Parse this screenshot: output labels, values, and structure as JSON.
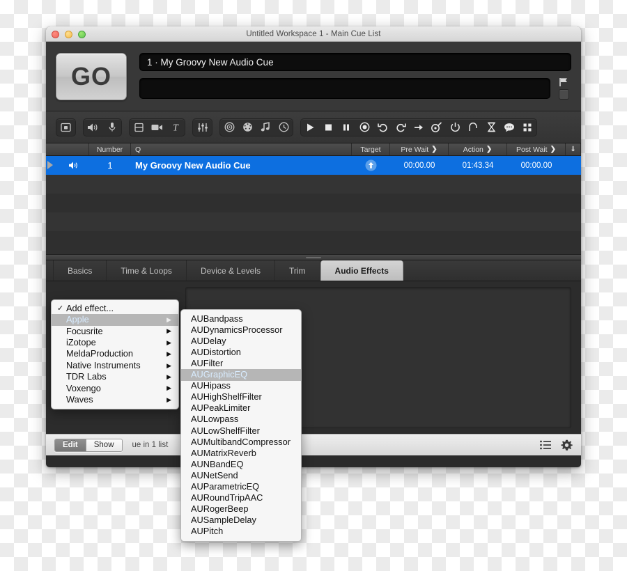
{
  "window": {
    "title": "Untitled Workspace 1 - Main Cue List",
    "traffic_lights": [
      "close",
      "minimize",
      "zoom"
    ]
  },
  "top": {
    "go_label": "GO",
    "cue_field_value": "1 · My Groovy New Audio Cue",
    "notes_field_value": "",
    "notes_placeholder": ""
  },
  "toolbar": {
    "groups": [
      {
        "name": "group-memo",
        "buttons": [
          {
            "icon": "memo-icon"
          }
        ]
      },
      {
        "name": "group-audio",
        "buttons": [
          {
            "icon": "speaker-icon"
          },
          {
            "icon": "microphone-icon"
          }
        ]
      },
      {
        "name": "group-media",
        "buttons": [
          {
            "icon": "fade-icon"
          },
          {
            "icon": "video-camera-icon"
          },
          {
            "icon": "text-icon"
          }
        ]
      },
      {
        "name": "group-levels",
        "buttons": [
          {
            "icon": "sliders-icon"
          }
        ]
      },
      {
        "name": "group-control",
        "buttons": [
          {
            "icon": "target-icon"
          },
          {
            "icon": "midi-icon"
          },
          {
            "icon": "music-note-icon"
          },
          {
            "icon": "clock-icon"
          }
        ]
      },
      {
        "name": "group-transport",
        "buttons": [
          {
            "icon": "play-icon"
          },
          {
            "icon": "stop-icon"
          },
          {
            "icon": "pause-icon"
          },
          {
            "icon": "record-icon"
          },
          {
            "icon": "undo-icon"
          },
          {
            "icon": "redo-icon"
          },
          {
            "icon": "arrow-right-icon"
          },
          {
            "icon": "goto-icon"
          },
          {
            "icon": "power-icon"
          },
          {
            "icon": "loop-icon"
          },
          {
            "icon": "hourglass-icon"
          },
          {
            "icon": "comment-icon"
          },
          {
            "icon": "grid-icon"
          }
        ]
      }
    ]
  },
  "cuelist": {
    "columns": [
      "",
      "Number",
      "Q",
      "Target",
      "Pre Wait",
      "Action",
      "Post Wait",
      ""
    ],
    "rows": [
      {
        "icon": "speaker-icon",
        "number": "1",
        "q": "My Groovy New Audio Cue",
        "target": "target-up-icon",
        "pre_wait": "00:00.00",
        "action": "01:43.34",
        "post_wait": "00:00.00",
        "selected": true
      }
    ],
    "empty_row_count": 4
  },
  "tabs": [
    {
      "label": "Basics",
      "active": false
    },
    {
      "label": "Time & Loops",
      "active": false
    },
    {
      "label": "Device & Levels",
      "active": false
    },
    {
      "label": "Trim",
      "active": false
    },
    {
      "label": "Audio Effects",
      "active": true
    }
  ],
  "bottom": {
    "segments": [
      {
        "label": "Edit",
        "active": true
      },
      {
        "label": "Show",
        "active": false
      }
    ],
    "status": "ue in 1 list",
    "icons": [
      {
        "icon": "list-icon"
      },
      {
        "icon": "gear-icon"
      }
    ]
  },
  "menu_vendors": {
    "items": [
      {
        "label": "Add effect...",
        "checked": true,
        "submenu": false,
        "highlighted": false
      },
      {
        "label": "Apple",
        "checked": false,
        "submenu": true,
        "highlighted": true
      },
      {
        "label": "Focusrite",
        "checked": false,
        "submenu": true,
        "highlighted": false
      },
      {
        "label": "iZotope",
        "checked": false,
        "submenu": true,
        "highlighted": false
      },
      {
        "label": "MeldaProduction",
        "checked": false,
        "submenu": true,
        "highlighted": false
      },
      {
        "label": "Native Instruments",
        "checked": false,
        "submenu": true,
        "highlighted": false
      },
      {
        "label": "TDR Labs",
        "checked": false,
        "submenu": true,
        "highlighted": false
      },
      {
        "label": "Voxengo",
        "checked": false,
        "submenu": true,
        "highlighted": false
      },
      {
        "label": "Waves",
        "checked": false,
        "submenu": true,
        "highlighted": false
      }
    ]
  },
  "menu_effects": {
    "items": [
      {
        "label": "AUBandpass",
        "highlighted": false
      },
      {
        "label": "AUDynamicsProcessor",
        "highlighted": false
      },
      {
        "label": "AUDelay",
        "highlighted": false
      },
      {
        "label": "AUDistortion",
        "highlighted": false
      },
      {
        "label": "AUFilter",
        "highlighted": false
      },
      {
        "label": "AUGraphicEQ",
        "highlighted": true
      },
      {
        "label": "AUHipass",
        "highlighted": false
      },
      {
        "label": "AUHighShelfFilter",
        "highlighted": false
      },
      {
        "label": "AUPeakLimiter",
        "highlighted": false
      },
      {
        "label": "AULowpass",
        "highlighted": false
      },
      {
        "label": "AULowShelfFilter",
        "highlighted": false
      },
      {
        "label": "AUMultibandCompressor",
        "highlighted": false
      },
      {
        "label": "AUMatrixReverb",
        "highlighted": false
      },
      {
        "label": "AUNBandEQ",
        "highlighted": false
      },
      {
        "label": "AUNetSend",
        "highlighted": false
      },
      {
        "label": "AUParametricEQ",
        "highlighted": false
      },
      {
        "label": "AURoundTripAAC",
        "highlighted": false
      },
      {
        "label": "AURogerBeep",
        "highlighted": false
      },
      {
        "label": "AUSampleDelay",
        "highlighted": false
      },
      {
        "label": "AUPitch",
        "highlighted": false
      }
    ]
  },
  "colors": {
    "selection_blue": "#0d6fe0",
    "window_chrome": "#383838",
    "menu_highlight": "#b6b6b6"
  }
}
